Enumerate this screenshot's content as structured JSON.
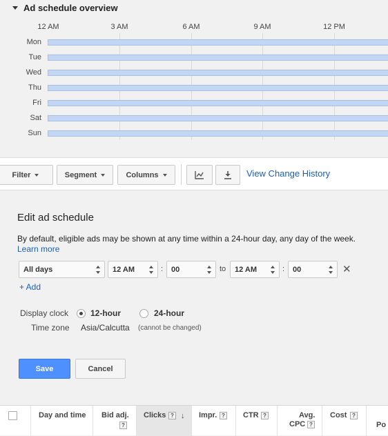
{
  "overview": {
    "title": "Ad schedule overview",
    "hours": [
      "12 AM",
      "3 AM",
      "6 AM",
      "9 AM",
      "12 PM"
    ],
    "days": [
      "Mon",
      "Tue",
      "Wed",
      "Thu",
      "Fri",
      "Sat",
      "Sun"
    ]
  },
  "toolbar": {
    "filter_label": "Filter",
    "segment_label": "Segment",
    "columns_label": "Columns",
    "chart_icon": "line-chart-icon",
    "download_icon": "download-icon",
    "history_link": "View Change History"
  },
  "edit": {
    "title": "Edit ad schedule",
    "description": "By default, eligible ads may be shown at any time within a 24-hour day, any day of the week.",
    "learn_more": "Learn more",
    "day_select": "All days",
    "start_hour": "12 AM",
    "start_minute": "00",
    "colon": ":",
    "to_label": "to",
    "end_hour": "12 AM",
    "end_minute": "00",
    "remove_icon": "close-icon",
    "add_link": "+ Add",
    "display_clock_label": "Display clock",
    "clock_12": "12-hour",
    "clock_24": "24-hour",
    "clock_selected": "12-hour",
    "timezone_label": "Time zone",
    "timezone_value": "Asia/Calcutta",
    "timezone_note": "(cannot be changed)",
    "save_label": "Save",
    "cancel_label": "Cancel"
  },
  "table": {
    "help_glyph": "?",
    "sort_glyph": "↓",
    "columns": {
      "day_time": "Day and time",
      "bid_adj": "Bid adj.",
      "clicks": "Clicks",
      "impr": "Impr.",
      "ctr": "CTR",
      "avg_cpc_1": "Avg.",
      "avg_cpc_2": "CPC",
      "cost": "Cost",
      "position": "Po"
    }
  },
  "colors": {
    "accent": "#4d90fe",
    "link": "#1a5fb4",
    "schedule_bar": "#c3d7f5"
  }
}
